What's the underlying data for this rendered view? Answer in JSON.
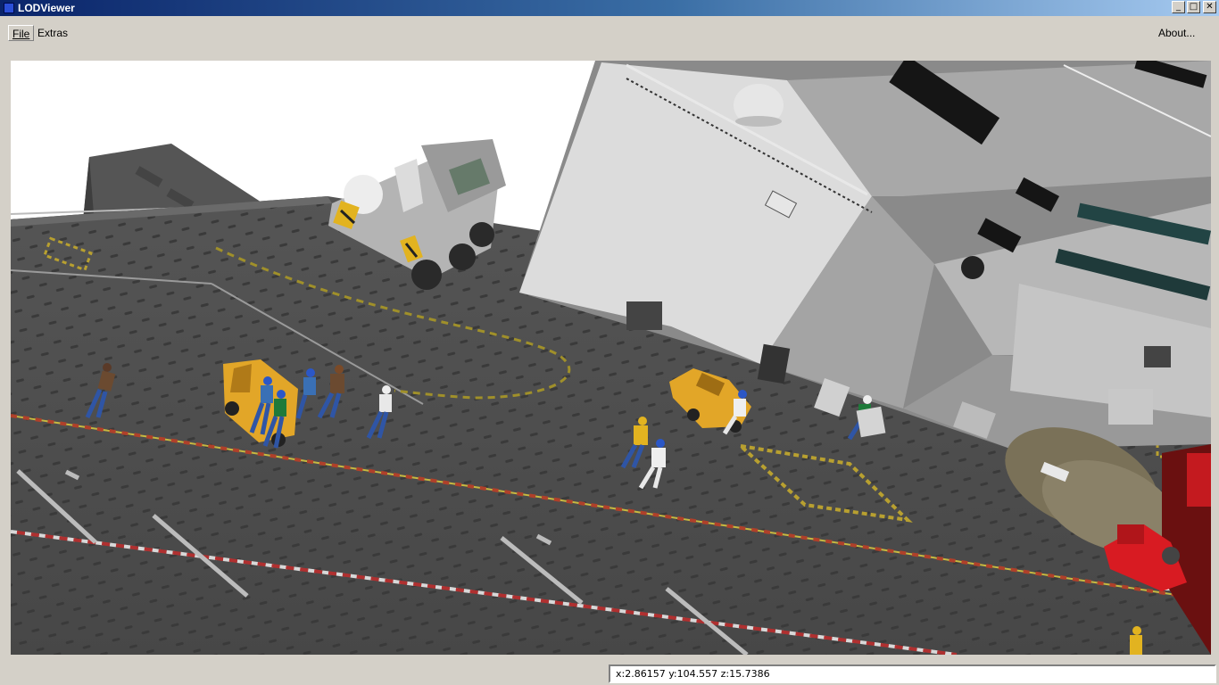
{
  "window": {
    "title": "LODViewer"
  },
  "window_controls": {
    "minimize": "_",
    "maximize": "□",
    "close": "✕"
  },
  "menu": {
    "file": "File",
    "extras": "Extras",
    "about": "About..."
  },
  "status": {
    "coordinates": "x:2.86157 y:104.557 z:15.7386"
  },
  "colors": {
    "titlebar_start": "#0a246a",
    "titlebar_end": "#a6caf0",
    "deck": "#4d4d4d",
    "tug": "#e2a628",
    "fire_truck": "#d81b22"
  }
}
